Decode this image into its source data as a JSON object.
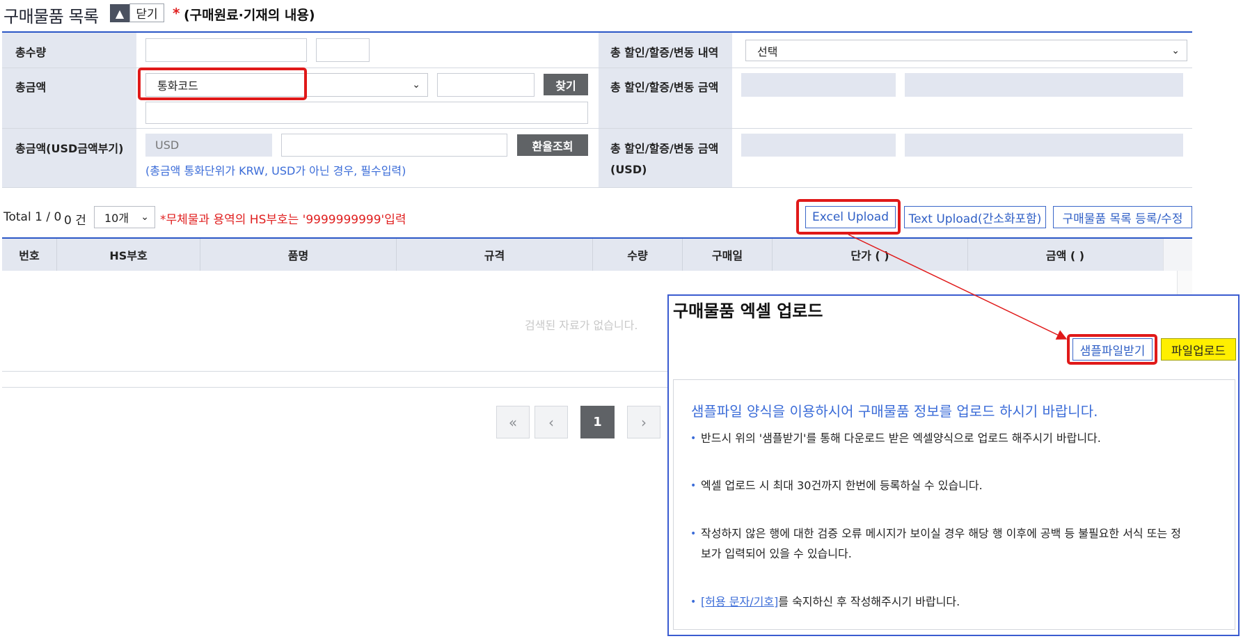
{
  "header": {
    "title": "구매물품 목록",
    "toggle_icon": "▲",
    "close_label": "닫기",
    "required_mark": "*",
    "note": "(구매원료·기재의 내용)"
  },
  "form": {
    "total_qty_label": "총수량",
    "total_amount_label": "총금액",
    "currency_placeholder": "통화코드",
    "find_button": "찾기",
    "total_usd_label": "총금액(USD금액부기)",
    "usd_value": "USD",
    "exchange_button": "환율조회",
    "usd_hint": "(총금액 통화단위가 KRW, USD가 아닌 경우, 필수입력)",
    "discount_detail_label": "총 할인/할증/변동 내역",
    "discount_select_value": "선택",
    "discount_amount_label": "총 할인/할증/변동 금액",
    "discount_amount_usd_label_line1": "총 할인/할증/변동 금액",
    "discount_amount_usd_label_line2": "(USD)"
  },
  "toolbar": {
    "total_text": "Total 1 / 0",
    "count_text": "0 건",
    "page_size": "10개",
    "warning": "*무체물과 용역의 HS부호는 '9999999999'입력",
    "excel_upload": "Excel Upload",
    "text_upload": "Text Upload(간소화포함)",
    "register_button": "구매물품 목록 등록/수정"
  },
  "grid": {
    "columns": [
      "번호",
      "HS부호",
      "품명",
      "규격",
      "수량",
      "구매일",
      "단가 ( )",
      "금액 ( )"
    ],
    "empty_message": "검색된 자료가 없습니다."
  },
  "pagination": {
    "first": "«",
    "prev": "‹",
    "current": "1",
    "next": "›"
  },
  "modal": {
    "title": "구매물품 엑셀 업로드",
    "sample_button": "샘플파일받기",
    "upload_button": "파일업로드",
    "info_heading": "샘플파일 양식을 이용하시어 구매물품 정보를 업로드 하시기 바랍니다.",
    "bullet_mark": "•",
    "items": [
      "반드시 위의 '샘플받기'를 통해 다운로드 받은 엑셀양식으로 업로드 해주시기 바랍니다.",
      "엑셀 업로드 시 최대 30건까지 한번에 등록하실 수 있습니다.",
      "작성하지 않은 행에 대한 검증 오류 메시지가 보이실 경우 해당 행 이후에 공백 등 불필요한 서식 또는 정",
      "보가 입력되어 있을 수 있습니다."
    ],
    "link_text": "[허용 문자/기호]",
    "link_suffix": "를 숙지하신 후 작성해주시기 바랍니다."
  },
  "colors": {
    "accent": "#2a56c6",
    "highlight": "#e01919",
    "upload_yellow": "#ffef00",
    "label_bg": "#e3e7f0"
  }
}
